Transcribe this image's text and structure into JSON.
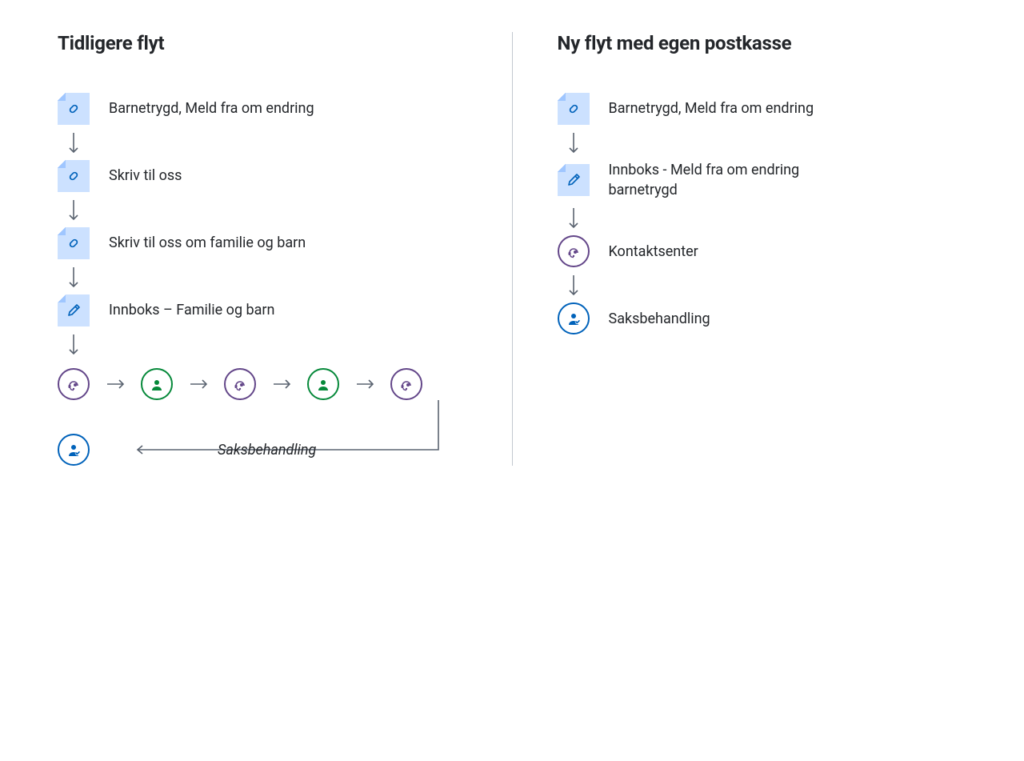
{
  "left": {
    "title": "Tidligere flyt",
    "steps": [
      {
        "icon": "link",
        "label": "Barnetrygd, Meld fra om endring"
      },
      {
        "icon": "link",
        "label": "Skriv til oss"
      },
      {
        "icon": "link",
        "label": "Skriv til oss om familie og barn"
      },
      {
        "icon": "pencil",
        "label": "Innboks – Familie og barn"
      }
    ],
    "row_icons": [
      "purple",
      "green",
      "purple",
      "green",
      "purple"
    ],
    "saks_label": "Saksbehandling"
  },
  "right": {
    "title": "Ny flyt med egen postkasse",
    "steps": [
      {
        "icon": "link",
        "label": "Barnetrygd, Meld fra om endring"
      },
      {
        "icon": "pencil",
        "label": "Innboks - Meld fra om endring barnetrygd"
      },
      {
        "icon": "headset-purple",
        "label": "Kontaktsenter"
      },
      {
        "icon": "caseworker-blue",
        "label": "Saksbehandling"
      }
    ]
  }
}
